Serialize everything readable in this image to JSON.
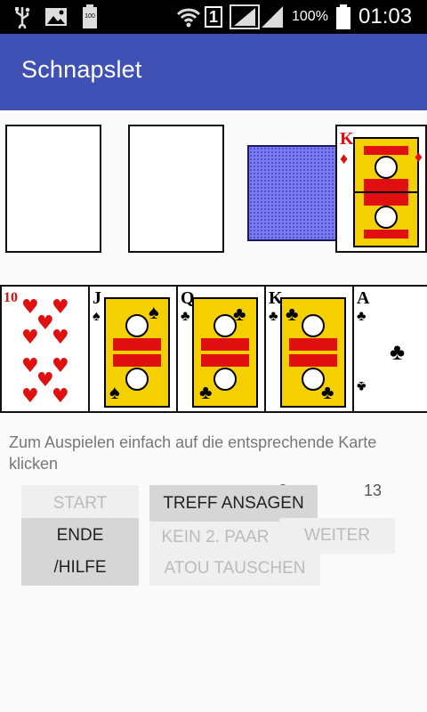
{
  "status_bar": {
    "battery_percent": "100%",
    "time": "01:03",
    "sim_badge": "1",
    "mini_battery_label": "100",
    "icons": [
      "usb-icon",
      "image-icon",
      "battery-small-icon",
      "wifi-icon",
      "signal-icon",
      "battery-icon"
    ]
  },
  "app_bar": {
    "title": "Schnapslet"
  },
  "game": {
    "top_row": [
      {
        "kind": "empty"
      },
      {
        "kind": "empty"
      },
      {
        "kind": "deck-back",
        "color": "#7b7bf0"
      },
      {
        "rank": "K",
        "suit": "diamonds",
        "color": "#e01010"
      }
    ],
    "hand": [
      {
        "rank": "10",
        "suit": "hearts",
        "color": "#e01010"
      },
      {
        "rank": "J",
        "suit": "spades",
        "color": "#000000"
      },
      {
        "rank": "Q",
        "suit": "clubs",
        "color": "#000000"
      },
      {
        "rank": "K",
        "suit": "clubs",
        "color": "#000000"
      },
      {
        "rank": "A",
        "suit": "clubs",
        "color": "#000000"
      }
    ],
    "message": "Zum Auspielen einfach auf die entsprechende Karte klicken",
    "score_left": "8",
    "score_right": "13"
  },
  "buttons": {
    "start": "START",
    "end_help": "ENDE\n/HILFE",
    "treff": "TREFF ANSAGEN",
    "kein": "KEIN 2. PAAR",
    "weiter": "WEITER",
    "atou": "ATOU TAUSCHEN"
  }
}
